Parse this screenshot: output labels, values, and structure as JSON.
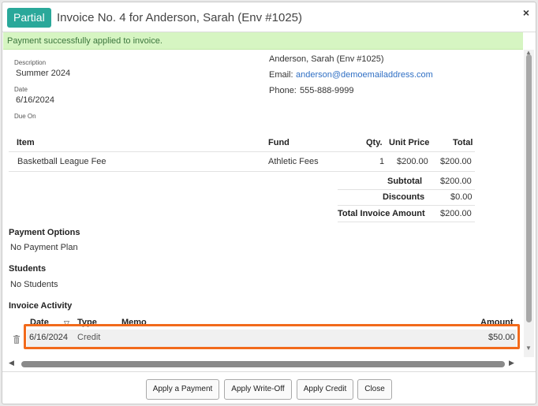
{
  "dialog": {
    "badge": "Partial",
    "title": "Invoice No. 4 for Anderson, Sarah (Env #1025)",
    "close_glyph": "×"
  },
  "alert": {
    "message": "Payment successfully applied to invoice."
  },
  "details": {
    "description_label": "Description",
    "description_value": "Summer 2024",
    "date_label": "Date",
    "date_value": "6/16/2024",
    "due_on_label": "Due On",
    "due_on_value": ""
  },
  "contact": {
    "name": "Anderson, Sarah (Env #1025)",
    "email_label": "Email:",
    "email": "anderson@demoemailaddress.com",
    "phone_label": "Phone:",
    "phone": "555-888-9999"
  },
  "line_items": {
    "headers": {
      "item": "Item",
      "fund": "Fund",
      "qty": "Qty.",
      "unit_price": "Unit Price",
      "total": "Total"
    },
    "rows": [
      {
        "item": "Basketball League Fee",
        "fund": "Athletic Fees",
        "qty": "1",
        "unit_price": "$200.00",
        "total": "$200.00"
      }
    ]
  },
  "totals": {
    "subtotal_label": "Subtotal",
    "subtotal": "$200.00",
    "discounts_label": "Discounts",
    "discounts": "$0.00",
    "total_label": "Total Invoice Amount",
    "total": "$200.00"
  },
  "payment_options": {
    "heading": "Payment Options",
    "value": "No Payment Plan"
  },
  "students": {
    "heading": "Students",
    "value": "No Students"
  },
  "activity": {
    "heading": "Invoice Activity",
    "headers": {
      "date": "Date",
      "type": "Type",
      "memo": "Memo",
      "amount": "Amount"
    },
    "sort_glyph": "▽",
    "rows": [
      {
        "date": "6/16/2024",
        "type": "Credit",
        "memo": "",
        "amount": "$50.00"
      }
    ]
  },
  "buttons": {
    "apply_payment": "Apply a Payment",
    "apply_writeoff": "Apply Write-Off",
    "apply_credit": "Apply Credit",
    "close": "Close"
  },
  "colors": {
    "badge": "#2aa89a",
    "alert_bg": "#d6f5c2",
    "alert_text": "#3c763d",
    "link": "#2f6fc4",
    "highlight": "#f26a1b"
  },
  "icons": {
    "close": "close-icon",
    "trash": "trash-icon",
    "sort": "sort-down-icon",
    "scroll_up": "chevron-up-icon",
    "scroll_down": "chevron-down-icon",
    "scroll_left": "chevron-left-icon",
    "scroll_right": "chevron-right-icon"
  }
}
